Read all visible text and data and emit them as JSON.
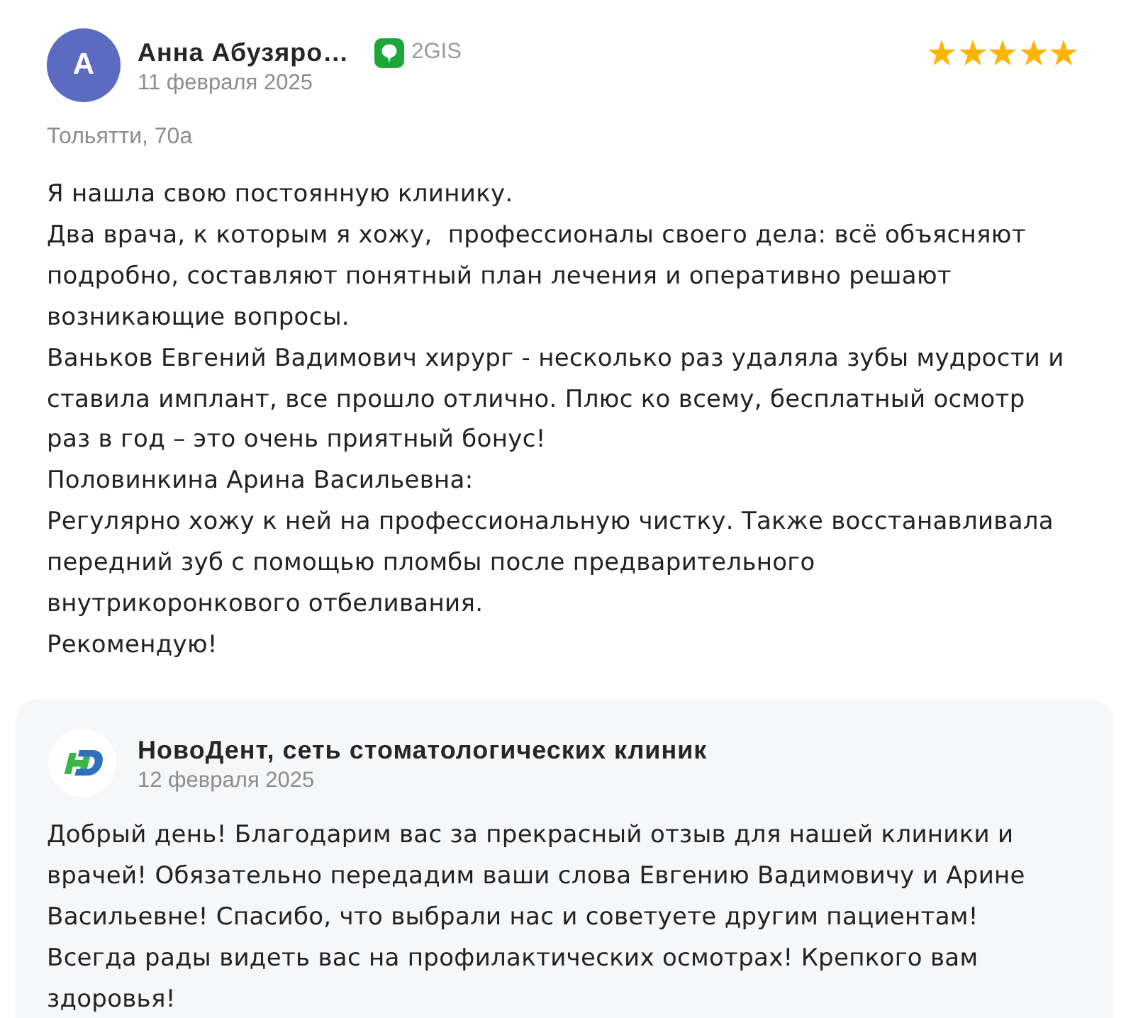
{
  "review": {
    "avatar_initial": "А",
    "author": "Анна Абузяро…",
    "source": "2GIS",
    "date": "11 февраля 2025",
    "stars": 5,
    "branch": "Тольятти, 70а",
    "text": "Я нашла свою постоянную клинику.\nДва врача, к которым я хожу,  профессионалы своего дела: всё объясняют подробно, составляют понятный план лечения и оперативно решают возникающие вопросы.\nВаньков Евгений Вадимович хирург - несколько раз удаляла зубы мудрости и ставила имплант, все прошло отлично. Плюс ко всему, бесплатный осмотр раз в год – это очень приятный бонус!\nПоловинкина Арина Васильевна:\nРегулярно хожу к ней на профессиональную чистку. Также восстанавливала передний зуб с помощью пломбы после предварительного внутрикоронкового отбеливания.\nРекомендую!"
  },
  "reply": {
    "author": "НовоДент, сеть стоматологических клиник",
    "date": "12 февраля 2025",
    "text": "Добрый день! Благодарим вас за прекрасный отзыв для нашей клиники и врачей! Обязательно передадим ваши слова Евгению Вадимовичу и Арине Васильевне! Спасибо, что выбрали нас и советуете другим пациентам! Всегда рады видеть вас на профилактических осмотрах! Крепкого вам здоровья!"
  }
}
